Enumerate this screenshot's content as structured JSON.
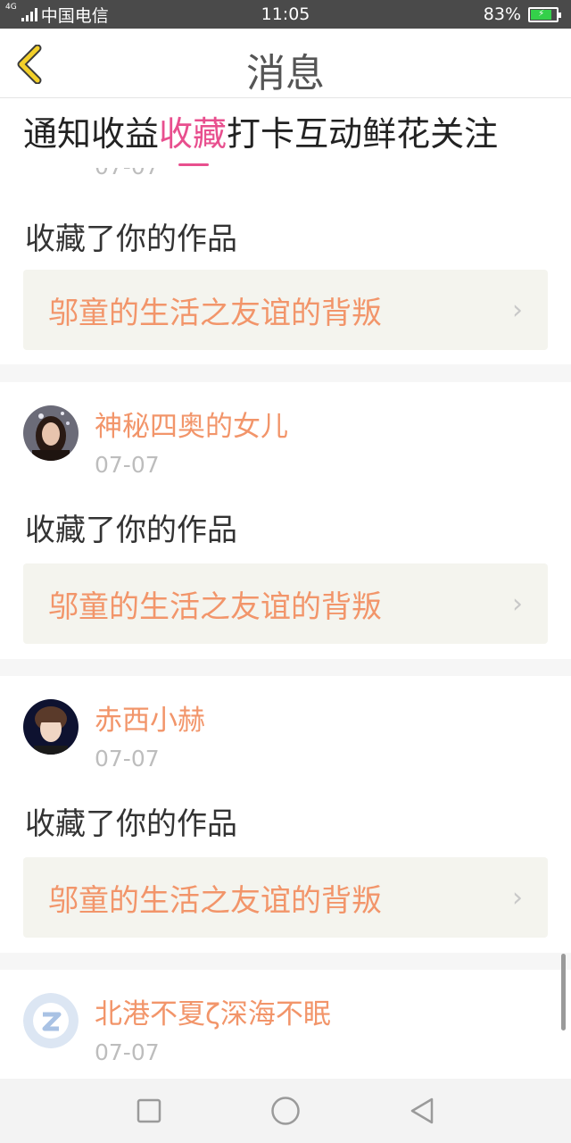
{
  "status_bar": {
    "carrier": "中国电信",
    "network": "4G",
    "time": "11:05",
    "battery": "83%",
    "battery_level": 0.83
  },
  "header": {
    "title": "消息",
    "back_icon": "chevron-left-icon"
  },
  "tabs": [
    {
      "label": "通知"
    },
    {
      "label": "收益"
    },
    {
      "label": "收藏",
      "active": true
    },
    {
      "label": "打卡"
    },
    {
      "label": "互动"
    },
    {
      "label": "鲜花"
    },
    {
      "label": "关注"
    }
  ],
  "first_card_cut": {
    "date": "07-07",
    "action": "收藏了你的作品",
    "work_title": "邬童的生活之友谊的背叛"
  },
  "items": [
    {
      "username": "神秘四奥的女儿",
      "date": "07-07",
      "action": "收藏了你的作品",
      "work_title": "邬童的生活之友谊的背叛"
    },
    {
      "username": "赤西小赫",
      "date": "07-07",
      "action": "收藏了你的作品",
      "work_title": "邬童的生活之友谊的背叛"
    },
    {
      "username": "北港不夏ζ深海不眠",
      "date": "07-07"
    }
  ],
  "colors": {
    "accent_pink": "#e84f8e",
    "name_orange": "#f2956a",
    "link_bg": "#f4f4ee"
  },
  "nav": {
    "recent_icon": "square-icon",
    "home_icon": "circle-icon",
    "back_icon": "triangle-back-icon"
  }
}
